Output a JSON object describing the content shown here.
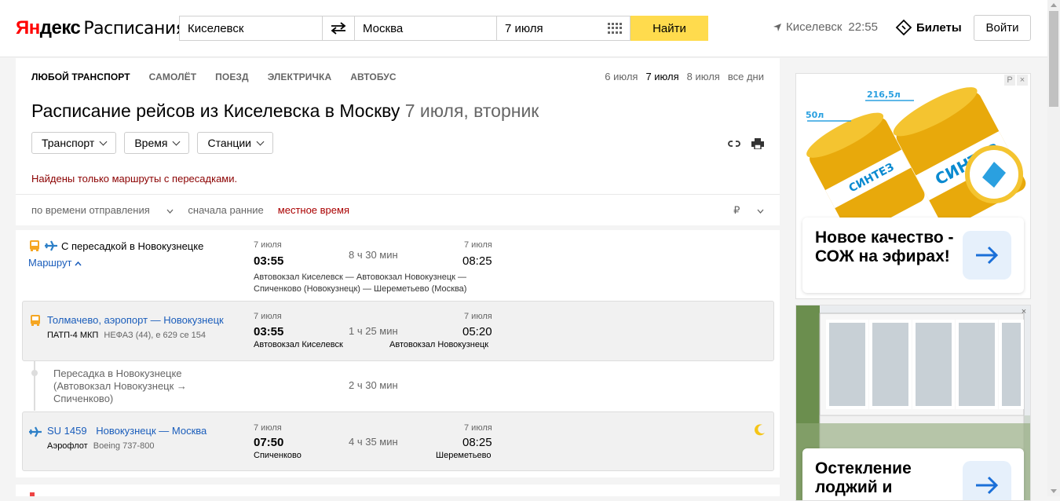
{
  "header": {
    "logo_ya": "Ян",
    "logo_ya2": "декс",
    "logo_service": "Расписания",
    "from_value": "Киселевск",
    "to_value": "Москва",
    "date_value": "7 июля",
    "find_label": "Найти",
    "city": "Киселевск",
    "local_time": "22:55",
    "tickets_label": "Билеты",
    "login_label": "Войти"
  },
  "tabs": [
    {
      "label": "ЛЮБОЙ ТРАНСПОРТ",
      "active": true
    },
    {
      "label": "САМОЛЁТ"
    },
    {
      "label": "ПОЕЗД"
    },
    {
      "label": "ЭЛЕКТРИЧКА"
    },
    {
      "label": "АВТОБУС"
    }
  ],
  "days": [
    {
      "label": "6 июля"
    },
    {
      "label": "7 июля",
      "active": true
    },
    {
      "label": "8 июля"
    },
    {
      "label": "все дни"
    }
  ],
  "title": {
    "main": "Расписание рейсов из Киселевска в Москву",
    "date": "7 июля, вторник"
  },
  "filters": {
    "transport": "Транспорт",
    "time": "Время",
    "stations": "Станции"
  },
  "warning": "Найдены только маршруты с пересадками.",
  "sort": {
    "by_departure": "по времени отправления",
    "order": "сначала ранние",
    "local_time": "местное время",
    "currency": "₽"
  },
  "trip": {
    "title": "С пересадкой в Новокузнецке",
    "route_toggle": "Маршрут",
    "dep_date": "7 июля",
    "dep_time": "03:55",
    "duration": "8 ч 30 мин",
    "arr_date": "7 июля",
    "arr_time": "08:25",
    "stations_line1": "Автовокзал Киселевск — Автовокзал Новокузнецк —",
    "stations_line2": "Спиченково (Новокузнецк) — Шереметьево (Москва)"
  },
  "segment1": {
    "name": "Толмачево, аэропорт — Новокузнецк",
    "carrier": "ПАТП-4 МКП",
    "vehicle": "НЕФАЗ (44), е 629 се 154",
    "dep_date": "7 июля",
    "dep_time": "03:55",
    "dep_station": "Автовокзал Киселевск",
    "duration": "1 ч 25 мин",
    "arr_date": "7 июля",
    "arr_time": "05:20",
    "arr_station": "Автовокзал Новокузнецк"
  },
  "transfer": {
    "line1": "Пересадка в Новокузнецке",
    "line2": "(Автовокзал Новокузнецк →",
    "line3": "Спиченково)",
    "duration": "2 ч 30 мин"
  },
  "segment2": {
    "flight": "SU 1459",
    "name": "Новокузнецк — Москва",
    "carrier": "Аэрофлот",
    "vehicle": "Boeing 737-800",
    "dep_date": "7 июля",
    "dep_time": "07:50",
    "dep_station": "Спиченково",
    "duration": "4 ч 35 мин",
    "arr_date": "7 июля",
    "arr_time": "08:25",
    "arr_station": "Шереметьево"
  },
  "ads": {
    "ad1_text": "Новое качество - СОЖ на эфирах!",
    "ad1_label_50": "50л",
    "ad1_label_216": "216,5л",
    "ad1_brand": "СИНТЕЗ",
    "ad_badge": "Р",
    "ad_close": "×",
    "ad2_text": "Остекление лоджий и"
  },
  "colors": {
    "accent_yellow": "#ffdb4d",
    "link_blue": "#1a5dbb",
    "warning_red": "#8b0000",
    "bus_orange": "#f5a623",
    "plane_blue": "#2c7fc7"
  }
}
